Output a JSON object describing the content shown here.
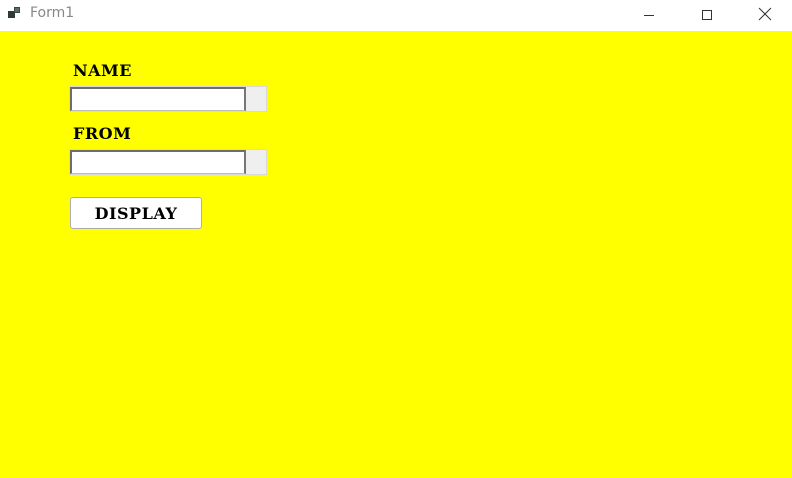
{
  "window": {
    "title": "Form1",
    "icons": {
      "app": "app-icon",
      "minimize": "minimize-icon",
      "maximize": "maximize-icon",
      "close": "close-icon"
    }
  },
  "form": {
    "background_color": "#ffff00",
    "name_label": "NAME",
    "name_value": "",
    "from_label": "FROM",
    "from_value": "",
    "display_button": "DISPLAY"
  }
}
